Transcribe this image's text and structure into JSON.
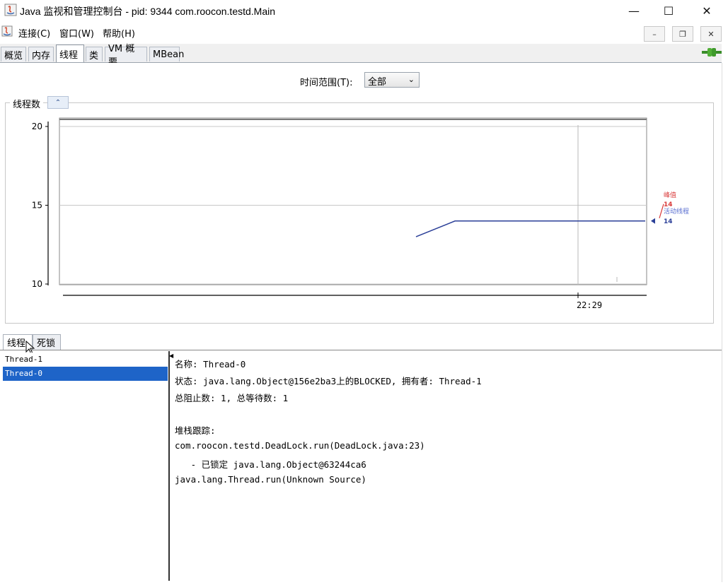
{
  "window": {
    "title": "Java 监视和管理控制台 - pid: 9344 com.roocon.testd.Main",
    "minimize": "—",
    "maximize": "☐",
    "close": "✕"
  },
  "menu": {
    "items": [
      "连接(C)",
      "窗口(W)",
      "帮助(H)"
    ]
  },
  "mdi": {
    "minimize": "–",
    "restore": "❐",
    "close": "✕"
  },
  "tabs": [
    "概览",
    "内存",
    "线程",
    "类",
    "VM 概要",
    "MBean"
  ],
  "active_tab": "线程",
  "time_range": {
    "label": "时间范围(T):",
    "value": "全部"
  },
  "chart_panel_title": "线程数",
  "collapse_glyph": "⌃",
  "chart_data": {
    "type": "line",
    "y_ticks": [
      20,
      15,
      10
    ],
    "ylim": [
      10,
      20
    ],
    "x_tick": "22:29",
    "series": [
      {
        "name": "峰值",
        "value": "14",
        "color": "#d93a3a"
      },
      {
        "name": "活动线程",
        "value": "14",
        "color": "#2b3f98",
        "points": [
          [
            0.0,
            13
          ],
          [
            0.17,
            14
          ],
          [
            1.0,
            14
          ]
        ]
      }
    ]
  },
  "bottom_tabs": [
    "线程",
    "死锁"
  ],
  "threads": [
    "Thread-1",
    "Thread-0"
  ],
  "selected_thread": "Thread-0",
  "detail": {
    "name": "名称: Thread-0",
    "state": "状态: java.lang.Object@156e2ba3上的BLOCKED, 拥有者: Thread-1",
    "counts": "总阻止数: 1, 总等待数: 1",
    "stack_title": "堆栈跟踪:",
    "stack": [
      "com.roocon.testd.DeadLock.run(DeadLock.java:23)",
      "   - 已锁定 java.lang.Object@63244ca6",
      "java.lang.Thread.run(Unknown Source)"
    ]
  }
}
